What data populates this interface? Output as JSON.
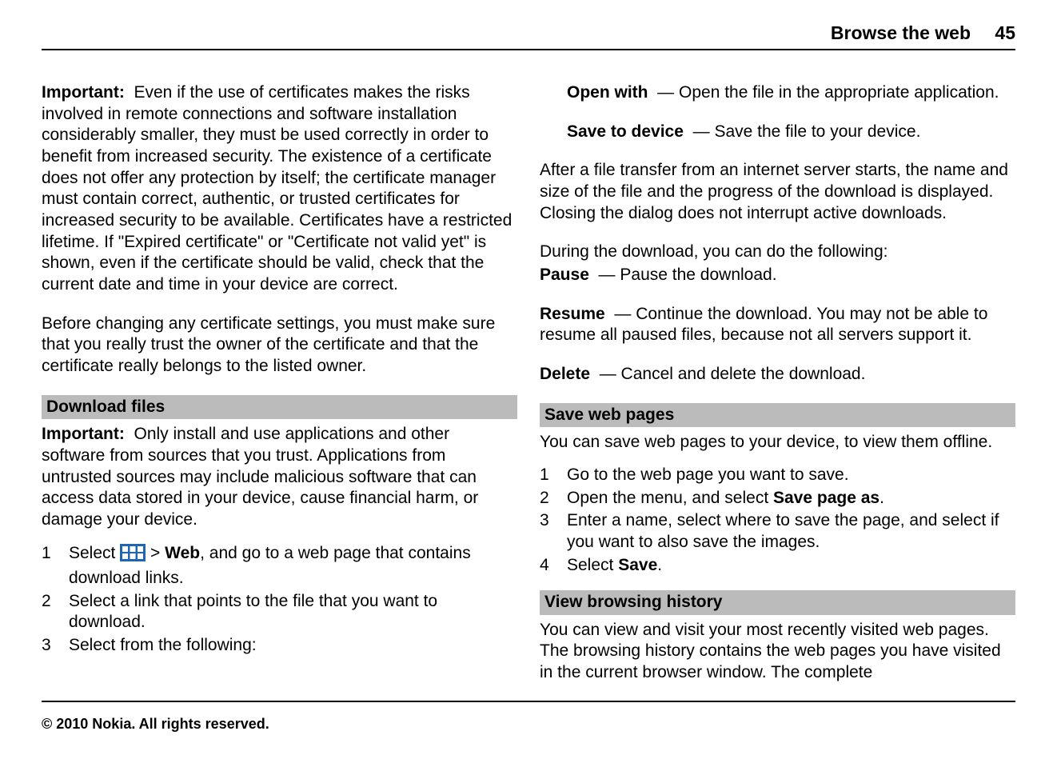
{
  "header": {
    "title": "Browse the web",
    "page_number": "45"
  },
  "left": {
    "important1": {
      "label": "Important:",
      "text": "Even if the use of certificates makes the risks involved in remote connections and software installation considerably smaller, they must be used correctly in order to benefit from increased security. The existence of a certificate does not offer any protection by itself; the certificate manager must contain correct, authentic, or trusted certificates for increased security to be available. Certificates have a restricted lifetime. If \"Expired certificate\" or \"Certificate not valid yet\" is shown, even if the certificate should be valid, check that the current date and time in your device are correct."
    },
    "p2": "Before changing any certificate settings, you must make sure that you really trust the owner of the certificate and that the certificate really belongs to the listed owner.",
    "heading_download": "Download files",
    "important2": {
      "label": "Important:",
      "text": "Only install and use applications and other software from sources that you trust. Applications from untrusted sources may include malicious software that can access data stored in your device, cause financial harm, or damage your device."
    },
    "steps": {
      "s1_prefix": "Select ",
      "s1_mid": " > ",
      "s1_web": "Web",
      "s1_suffix": ", and go to a web page that contains download links.",
      "s2": "Select a link that points to the file that you want to download.",
      "s3": "Select from the following:"
    }
  },
  "right": {
    "open_with": {
      "label": "Open with",
      "text": "Open the file in the appropriate application."
    },
    "save_to_device": {
      "label": "Save to device",
      "text": "Save the file to your device."
    },
    "p_transfer": "After a file transfer from an internet server starts, the name and size of the file and the progress of the download is displayed. Closing the dialog does not interrupt active downloads.",
    "p_during": "During the download, you can do the following:",
    "pause": {
      "label": "Pause",
      "text": "Pause the download."
    },
    "resume": {
      "label": "Resume",
      "text": "Continue the download. You may not be able to resume all paused files, because not all servers support it."
    },
    "delete": {
      "label": "Delete",
      "text": "Cancel and delete the download."
    },
    "heading_save": "Save web pages",
    "p_save_intro": "You can save web pages to your device, to view them offline.",
    "save_steps": {
      "s1": "Go to the web page you want to save.",
      "s2_prefix": "Open the menu, and select ",
      "s2_bold": "Save page as",
      "s2_suffix": ".",
      "s3": "Enter a name, select where to save the page, and select if you want to also save the images.",
      "s4_prefix": "Select ",
      "s4_bold": "Save",
      "s4_suffix": "."
    },
    "heading_history": "View browsing history",
    "p_history": "You can view and visit your most recently visited web pages. The browsing history contains the web pages you have visited in the current browser window. The complete"
  },
  "footer": "© 2010 Nokia. All rights reserved."
}
